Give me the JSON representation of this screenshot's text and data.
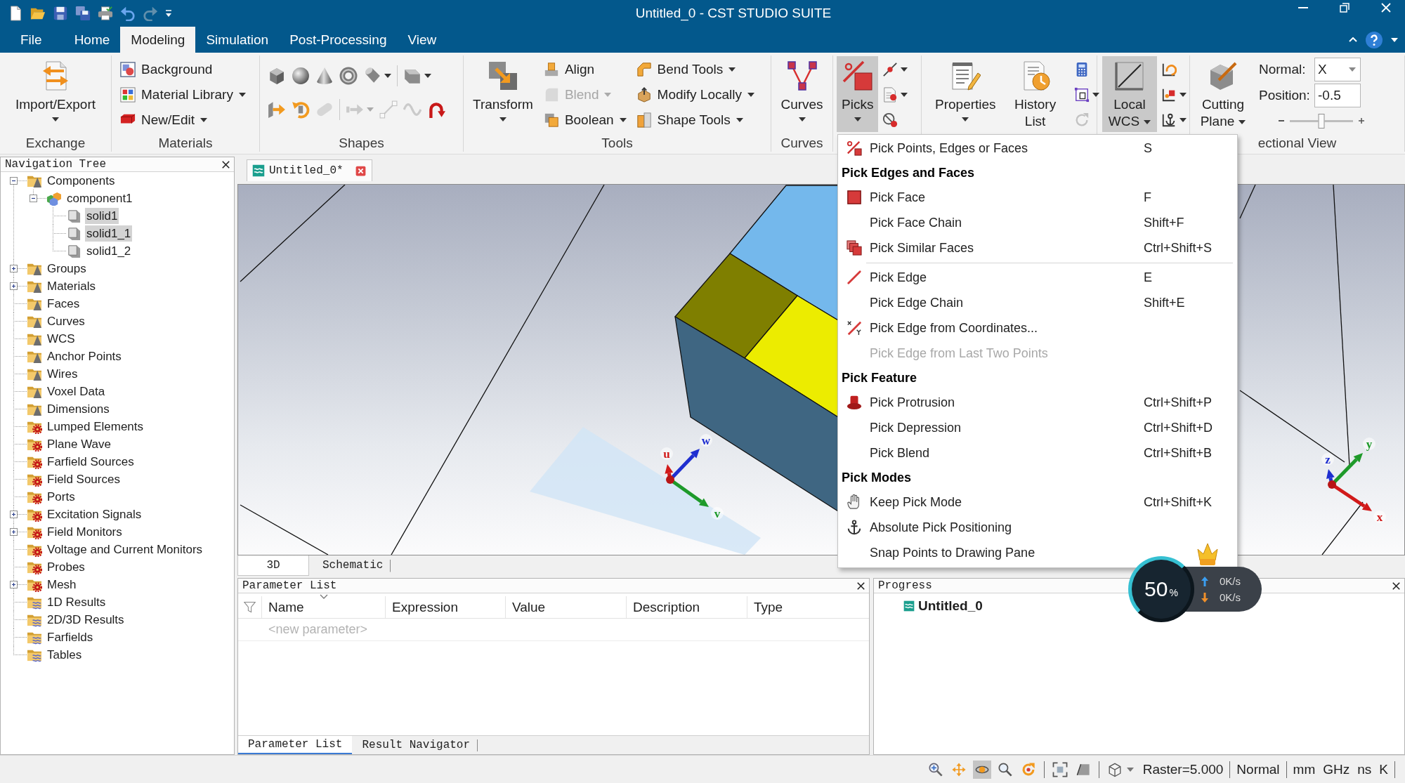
{
  "title_bar": {
    "title": "Untitled_0 - CST STUDIO SUITE",
    "quick_access": [
      {
        "disabled": false
      },
      {
        "disabled": false
      },
      {
        "disabled": false
      },
      {
        "disabled": false
      },
      {
        "disabled": false
      },
      {
        "disabled": false
      },
      {
        "disabled": true
      }
    ]
  },
  "menu_tabs": [
    {
      "label": "File",
      "selected": false
    },
    {
      "label": "Home",
      "selected": false
    },
    {
      "label": "Modeling",
      "selected": true
    },
    {
      "label": "Simulation",
      "selected": false
    },
    {
      "label": "Post-Processing",
      "selected": false
    },
    {
      "label": "View",
      "selected": false
    }
  ],
  "ribbon": {
    "exchange": {
      "label": "Exchange",
      "button": {
        "label": "Import/Export",
        "dropdown": true
      }
    },
    "materials": {
      "label": "Materials",
      "buttons": [
        {
          "label": "Background",
          "dropdown": false
        },
        {
          "label": "Material Library",
          "dropdown": true
        },
        {
          "label": "New/Edit",
          "dropdown": true
        }
      ]
    },
    "shapes": {
      "label": "Shapes",
      "rows": [
        [
          {
            "disabled": false,
            "dropdown": false
          },
          {
            "disabled": false,
            "dropdown": false
          },
          {
            "disabled": false,
            "dropdown": false
          },
          {
            "disabled": false,
            "dropdown": false
          },
          {
            "disabled": false,
            "dropdown": true
          },
          {
            "disabled": false,
            "dropdown": true
          }
        ],
        [
          {
            "disabled": false,
            "dropdown": false
          },
          {
            "disabled": false,
            "dropdown": false
          },
          {
            "disabled": true,
            "dropdown": false
          },
          {
            "disabled": true,
            "dropdown": true
          },
          {
            "disabled": true,
            "dropdown": false
          },
          {
            "disabled": true,
            "dropdown": false
          },
          {
            "disabled": false,
            "dropdown": false
          }
        ]
      ]
    },
    "tools": {
      "label": "Tools",
      "transform": {
        "label": "Transform",
        "dropdown": true
      },
      "buttons": [
        {
          "label": "Align",
          "disabled": false,
          "dropdown": false
        },
        {
          "label": "Blend",
          "disabled": true,
          "dropdown": true
        },
        {
          "label": "Boolean",
          "disabled": false,
          "dropdown": true
        },
        {
          "label": "Bend Tools",
          "disabled": false,
          "dropdown": true
        },
        {
          "label": "Modify Locally",
          "disabled": false,
          "dropdown": true
        },
        {
          "label": "Shape Tools",
          "disabled": false,
          "dropdown": true
        }
      ]
    },
    "curves": {
      "label": "Curves",
      "button": {
        "label": "Curves",
        "dropdown": true
      }
    },
    "picks": {
      "button": {
        "label": "Picks",
        "pressed": true,
        "dropdown": true
      },
      "tools": [
        {
          "disabled": false,
          "dropdown": true
        },
        {
          "disabled": false,
          "dropdown": true
        },
        {
          "disabled": false,
          "dropdown": false
        }
      ]
    },
    "properties": {
      "buttons": [
        {
          "label": "Properties",
          "dropdown": true
        },
        {
          "label": "History List",
          "dropdown": false
        }
      ],
      "tools": [
        {
          "disabled": false,
          "dropdown": false
        },
        {
          "disabled": false,
          "dropdown": true
        },
        {
          "disabled": true,
          "dropdown": false
        }
      ]
    },
    "wcs": {
      "button": {
        "label": "Local WCS",
        "pressed": true,
        "dropdown": true
      },
      "tools": [
        {
          "disabled": false,
          "dropdown": false
        },
        {
          "disabled": false,
          "dropdown": true
        },
        {
          "disabled": false,
          "dropdown": true
        }
      ]
    },
    "sectional_view": {
      "label": "ectional View",
      "button": {
        "label": "Cutting Plane",
        "dropdown": true
      },
      "normal": {
        "label": "Normal:",
        "value": "X"
      },
      "position": {
        "label": "Position:",
        "value": "-0.5"
      },
      "slider": {
        "level": 0.5
      }
    }
  },
  "navigation_tree": {
    "title": "Navigation Tree",
    "items": [
      {
        "label": "Components",
        "kind": "geometry",
        "expanded": true,
        "selected": false,
        "children": [
          {
            "label": "component1",
            "kind": "component",
            "expanded": true,
            "selected": false,
            "children": [
              {
                "label": "solid1",
                "kind": "solid",
                "selected": true
              },
              {
                "label": "solid1_1",
                "kind": "solid",
                "selected": true
              },
              {
                "label": "solid1_2",
                "kind": "solid",
                "selected": false
              }
            ]
          }
        ]
      },
      {
        "label": "Groups",
        "kind": "geometry",
        "expanded": false,
        "selected": false
      },
      {
        "label": "Materials",
        "kind": "geometry",
        "expanded": false,
        "selected": false
      },
      {
        "label": "Faces",
        "kind": "geometry",
        "selected": false
      },
      {
        "label": "Curves",
        "kind": "geometry",
        "selected": false
      },
      {
        "label": "WCS",
        "kind": "geometry",
        "selected": false
      },
      {
        "label": "Anchor Points",
        "kind": "geometry",
        "selected": false
      },
      {
        "label": "Wires",
        "kind": "geometry",
        "selected": false
      },
      {
        "label": "Voxel Data",
        "kind": "geometry",
        "selected": false
      },
      {
        "label": "Dimensions",
        "kind": "geometry",
        "selected": false
      },
      {
        "label": "Lumped Elements",
        "kind": "source",
        "selected": false
      },
      {
        "label": "Plane Wave",
        "kind": "source",
        "selected": false
      },
      {
        "label": "Farfield Sources",
        "kind": "source",
        "selected": false
      },
      {
        "label": "Field Sources",
        "kind": "source",
        "selected": false
      },
      {
        "label": "Ports",
        "kind": "source",
        "selected": false
      },
      {
        "label": "Excitation Signals",
        "kind": "source",
        "expanded": false,
        "selected": false
      },
      {
        "label": "Field Monitors",
        "kind": "source",
        "expanded": false,
        "selected": false
      },
      {
        "label": "Voltage and Current Monitors",
        "kind": "source",
        "selected": false
      },
      {
        "label": "Probes",
        "kind": "source",
        "selected": false
      },
      {
        "label": "Mesh",
        "kind": "source",
        "expanded": false,
        "selected": false
      },
      {
        "label": "1D Results",
        "kind": "result",
        "selected": false
      },
      {
        "label": "2D/3D Results",
        "kind": "result",
        "selected": false
      },
      {
        "label": "Farfields",
        "kind": "result",
        "selected": false
      },
      {
        "label": "Tables",
        "kind": "result",
        "selected": false
      }
    ]
  },
  "document_tabs": [
    {
      "label": "Untitled_0*",
      "selected": true
    }
  ],
  "viewport": {
    "local_axes": [
      "u",
      "v",
      "w"
    ],
    "global_axes": [
      "x",
      "y",
      "z"
    ]
  },
  "view_tabs": [
    {
      "label": "3D",
      "selected": true
    },
    {
      "label": "Schematic",
      "selected": false
    }
  ],
  "parameter_list": {
    "title": "Parameter List",
    "columns": [
      "Name",
      "Expression",
      "Value",
      "Description",
      "Type"
    ],
    "placeholder": "<new parameter>"
  },
  "panel_tabs": [
    {
      "label": "Parameter List",
      "selected": true
    },
    {
      "label": "Result Navigator",
      "selected": false
    }
  ],
  "progress": {
    "title": "Progress",
    "items": [
      {
        "label": "Untitled_0"
      }
    ]
  },
  "pick_menu": {
    "items": [
      {
        "kind": "item",
        "label": "Pick Points, Edges or Faces",
        "shortcut": "S",
        "disabled": false
      },
      {
        "kind": "header",
        "label": "Pick Edges and Faces"
      },
      {
        "kind": "item",
        "label": "Pick Face",
        "shortcut": "F",
        "disabled": false
      },
      {
        "kind": "item",
        "label": "Pick Face Chain",
        "shortcut": "Shift+F",
        "disabled": false
      },
      {
        "kind": "item",
        "label": "Pick Similar Faces",
        "shortcut": "Ctrl+Shift+S",
        "disabled": false
      },
      {
        "kind": "separator"
      },
      {
        "kind": "item",
        "label": "Pick Edge",
        "shortcut": "E",
        "disabled": false
      },
      {
        "kind": "item",
        "label": "Pick Edge Chain",
        "shortcut": "Shift+E",
        "disabled": false
      },
      {
        "kind": "item",
        "label": "Pick Edge from Coordinates...",
        "disabled": false
      },
      {
        "kind": "item",
        "label": "Pick Edge from Last Two Points",
        "disabled": true
      },
      {
        "kind": "header",
        "label": "Pick Feature"
      },
      {
        "kind": "item",
        "label": "Pick Protrusion",
        "shortcut": "Ctrl+Shift+P",
        "disabled": false
      },
      {
        "kind": "item",
        "label": "Pick Depression",
        "shortcut": "Ctrl+Shift+D",
        "disabled": false
      },
      {
        "kind": "item",
        "label": "Pick Blend",
        "shortcut": "Ctrl+Shift+B",
        "disabled": false
      },
      {
        "kind": "header",
        "label": "Pick Modes"
      },
      {
        "kind": "item",
        "label": "Keep Pick Mode",
        "shortcut": "Ctrl+Shift+K",
        "disabled": false
      },
      {
        "kind": "item",
        "label": "Absolute Pick Positioning",
        "disabled": false
      },
      {
        "kind": "item",
        "label": "Snap Points to Drawing Pane",
        "disabled": false
      }
    ]
  },
  "status_bar": {
    "tools": [
      {
        "pressed": false,
        "dropdown": false
      },
      {
        "pressed": false,
        "dropdown": false
      },
      {
        "pressed": true,
        "dropdown": false
      },
      {
        "pressed": false,
        "dropdown": false
      },
      {
        "pressed": false,
        "dropdown": false
      },
      {
        "pressed": false,
        "dropdown": false
      },
      {
        "pressed": false,
        "dropdown": false
      },
      {
        "pressed": false,
        "dropdown": true
      }
    ],
    "fields": [
      "Raster=5.000",
      "Normal"
    ],
    "units": [
      "mm",
      "GHz",
      "ns",
      "K"
    ]
  },
  "speed_widget": {
    "percent": "50",
    "unit": "%",
    "upload": "0K/s",
    "download": "0K/s"
  }
}
